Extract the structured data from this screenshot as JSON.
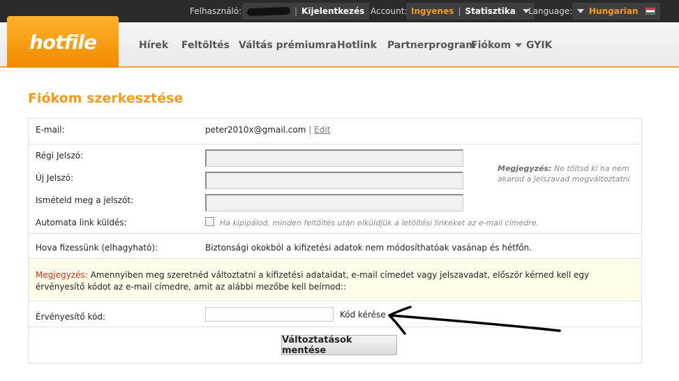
{
  "topbar": {
    "user_label": "Felhasználó:",
    "logout": "Kijelentkezés",
    "account_label": "Account:",
    "account_type": "Ingyenes",
    "stats": "Statisztika",
    "language_label": "Language:",
    "language_value": "Hungarian"
  },
  "logo": {
    "text": "hotfile"
  },
  "nav": [
    "Hírek",
    "Feltöltés",
    "Váltás prémiumra",
    "Hotlink",
    "Partnerprogram",
    "Fiókom",
    "GYIK"
  ],
  "page": {
    "title": "Fiókom szerkesztése"
  },
  "form": {
    "email_label": "E-mail:",
    "email_value": "peter2010x@gmail.com",
    "email_sep": "|",
    "edit_link": "Edit",
    "old_pw_label": "Régi Jelszó:",
    "new_pw_label": "Új Jelszó:",
    "repeat_pw_label": "Ismételd meg a jelszót:",
    "side_note_bold": "Megjegyzés:",
    "side_note_text": "Ne töltsd ki ha nem akarod a jelszavad megváltoztatni",
    "auto_link_label": "Automata link küldés:",
    "auto_link_text": "Ha kipipálod, minden feltöltés után elküldjük a letöltési linkeket az e-mail címedre.",
    "payout_label": "Hova fizessünk (elhagyható):",
    "payout_text": "Biztonsági okokból a kifizetési adatok nem módosíthatóak vasánap és hétfőn.",
    "warning_red": "Megjegyzés:",
    "warning_text": " Amennyiben meg szeretnéd változtatni a kifizetési adataidat, e-mail címedet vagy jelszavadat, először kérned kell egy érvényesítő kódot az e-mail címedre, amit az alábbi mezőbe kell beírnod::",
    "code_label": "Érvényesítő kód:",
    "code_request": "Kód kérése",
    "save_button": "Változtatások mentése"
  }
}
